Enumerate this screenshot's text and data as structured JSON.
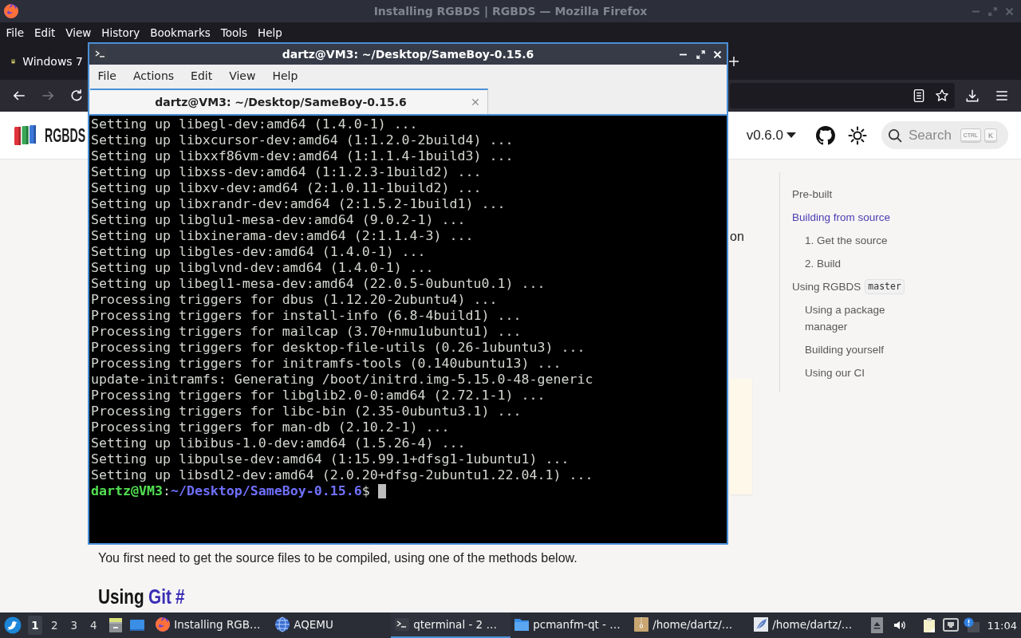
{
  "browser": {
    "title": "Installing RGBDS | RGBDS — Mozilla Firefox",
    "menu": [
      "File",
      "Edit",
      "View",
      "History",
      "Bookmarks",
      "Tools",
      "Help"
    ],
    "tabs": [
      {
        "label": "Windows 7",
        "selected": false
      }
    ],
    "navigation": [
      {
        "kind": "back",
        "disabled": false
      },
      {
        "kind": "forward",
        "disabled": true
      },
      {
        "kind": "reload",
        "disabled": false
      }
    ],
    "page": {
      "site_name": "RGBDS",
      "version": "v0.6.0",
      "search": {
        "placeholder": "Search",
        "keys": [
          "CTRL",
          "K"
        ]
      },
      "fragment": "on",
      "paragraph": "You first need to get the source files to be compiled, using one of the methods below.",
      "heading": {
        "text": "Using",
        "link": "Git",
        "anchor": "#"
      },
      "toc": [
        {
          "label": "Pre-built",
          "selected": false
        },
        {
          "label": "Building from source",
          "selected": true,
          "children": [
            {
              "label": "1. Get the source",
              "selected": false
            },
            {
              "label": "2. Build",
              "selected": false
            }
          ]
        },
        {
          "label": "Using RGBDS",
          "code": "master",
          "selected": false,
          "children": [
            {
              "label": "Using a package manager",
              "selected": false
            },
            {
              "label": "Building yourself",
              "selected": false
            },
            {
              "label": "Using our CI",
              "selected": false
            }
          ]
        }
      ]
    }
  },
  "terminal": {
    "title": "dartz@VM3: ~/Desktop/SameBoy-0.15.6",
    "menu": [
      "File",
      "Actions",
      "Edit",
      "View",
      "Help"
    ],
    "tabs": [
      {
        "label": "dartz@VM3: ~/Desktop/SameBoy-0.15.6",
        "selected": true
      }
    ],
    "lines": [
      "Setting up libegl-dev:amd64 (1.4.0-1) ...",
      "Setting up libxcursor-dev:amd64 (1:1.2.0-2build4) ...",
      "Setting up libxxf86vm-dev:amd64 (1:1.1.4-1build3) ...",
      "Setting up libxss-dev:amd64 (1:1.2.3-1build2) ...",
      "Setting up libxv-dev:amd64 (2:1.0.11-1build2) ...",
      "Setting up libxrandr-dev:amd64 (2:1.5.2-1build1) ...",
      "Setting up libglu1-mesa-dev:amd64 (9.0.2-1) ...",
      "Setting up libxinerama-dev:amd64 (2:1.1.4-3) ...",
      "Setting up libgles-dev:amd64 (1.4.0-1) ...",
      "Setting up libglvnd-dev:amd64 (1.4.0-1) ...",
      "Setting up libegl1-mesa-dev:amd64 (22.0.5-0ubuntu0.1) ...",
      "Processing triggers for dbus (1.12.20-2ubuntu4) ...",
      "Processing triggers for install-info (6.8-4build1) ...",
      "Processing triggers for mailcap (3.70+nmu1ubuntu1) ...",
      "Processing triggers for desktop-file-utils (0.26-1ubuntu3) ...",
      "Processing triggers for initramfs-tools (0.140ubuntu13) ...",
      "update-initramfs: Generating /boot/initrd.img-5.15.0-48-generic",
      "Processing triggers for libglib2.0-0:amd64 (2.72.1-1) ...",
      "Processing triggers for libc-bin (2.35-0ubuntu3.1) ...",
      "Processing triggers for man-db (2.10.2-1) ...",
      "Setting up libibus-1.0-dev:amd64 (1.5.26-4) ...",
      "Setting up libpulse-dev:amd64 (1:15.99.1+dfsg1-1ubuntu1) ...",
      "Setting up libsdl2-dev:amd64 (2.0.20+dfsg-2ubuntu1.22.04.1) ..."
    ],
    "prompt": {
      "user": "dartz@VM3",
      "separator": ":",
      "path": "~/Desktop/SameBoy-0.15.6",
      "symbol": "$"
    }
  },
  "taskbar": {
    "workspaces": [
      {
        "label": "1",
        "selected": true
      },
      {
        "label": "2",
        "selected": false
      },
      {
        "label": "3",
        "selected": false
      },
      {
        "label": "4",
        "selected": false
      }
    ],
    "tasks": [
      {
        "kind": "browser",
        "label": "Installing RGB…",
        "selected": false
      },
      {
        "kind": "emulator",
        "label": "AQEMU",
        "selected": false
      },
      {
        "kind": "terminal",
        "label": "qterminal - 2 …",
        "selected": true
      },
      {
        "kind": "files",
        "label": "pcmanfm-qt - …",
        "selected": false
      },
      {
        "kind": "archive",
        "label": "/home/dartz/…",
        "selected": false
      },
      {
        "kind": "editor",
        "label": "/home/dartz/…",
        "selected": false
      }
    ],
    "clock": "11:04"
  }
}
